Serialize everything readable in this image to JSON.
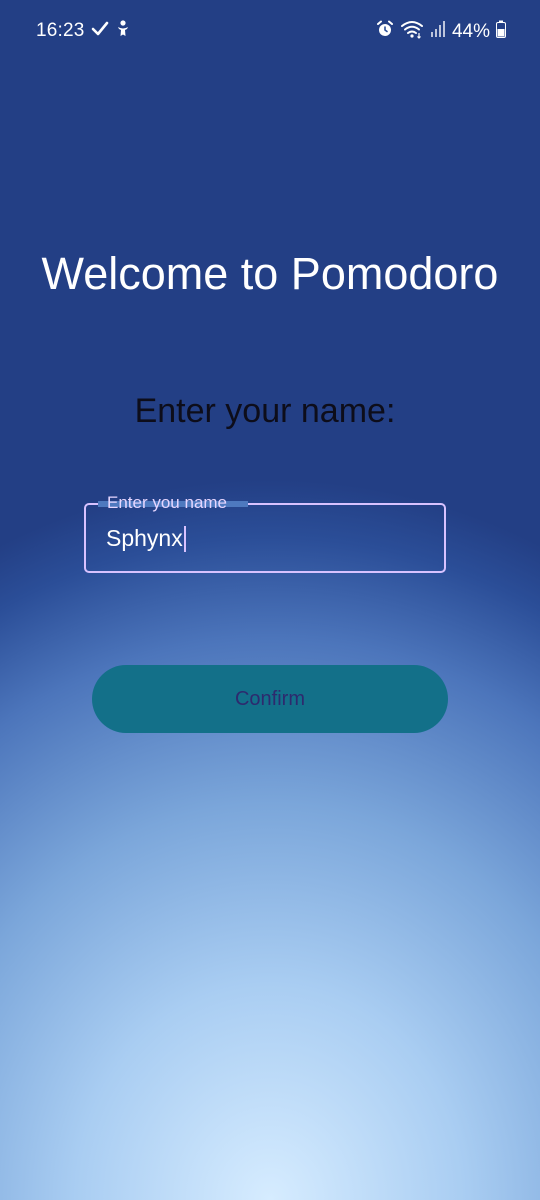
{
  "status_bar": {
    "time": "16:23",
    "battery_percent": "44%",
    "left_icons": [
      "check-icon",
      "accessibility-icon"
    ],
    "right_icons": [
      "alarm-icon",
      "wifi-icon",
      "signal-icon",
      "battery-icon"
    ]
  },
  "screen": {
    "title": "Welcome to Pomodoro",
    "prompt": "Enter your name:",
    "name_field": {
      "label": "Enter you name",
      "value": "Sphynx"
    },
    "confirm_label": "Confirm"
  },
  "colors": {
    "field_border": "#d8c2ff",
    "button_background": "#137089",
    "button_text": "#2d2a6e"
  }
}
